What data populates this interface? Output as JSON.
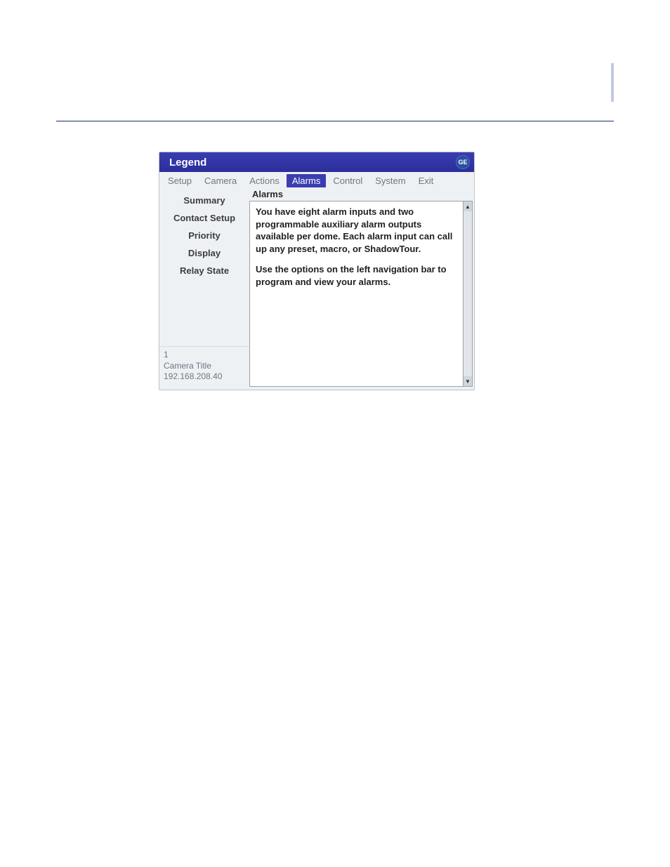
{
  "window": {
    "title": "Legend",
    "logo_label": "GE"
  },
  "menu": {
    "items": [
      {
        "label": "Setup"
      },
      {
        "label": "Camera"
      },
      {
        "label": "Actions"
      },
      {
        "label": "Alarms",
        "active": true
      },
      {
        "label": "Control"
      },
      {
        "label": "System"
      },
      {
        "label": "Exit"
      }
    ]
  },
  "sidebar": {
    "items": [
      {
        "label": "Summary"
      },
      {
        "label": "Contact Setup"
      },
      {
        "label": "Priority"
      },
      {
        "label": "Display"
      },
      {
        "label": "Relay State"
      }
    ]
  },
  "camera_info": {
    "index": "1",
    "title": "Camera Title",
    "ip": "192.168.208.40"
  },
  "panel": {
    "heading": "Alarms",
    "para1": "You have eight alarm inputs and two programmable auxiliary alarm outputs available per dome. Each alarm input can call up any preset, macro, or ShadowTour.",
    "para2": "Use the options on the left navigation bar to program and view your alarms."
  },
  "scroll": {
    "up": "▲",
    "down": "▼"
  }
}
